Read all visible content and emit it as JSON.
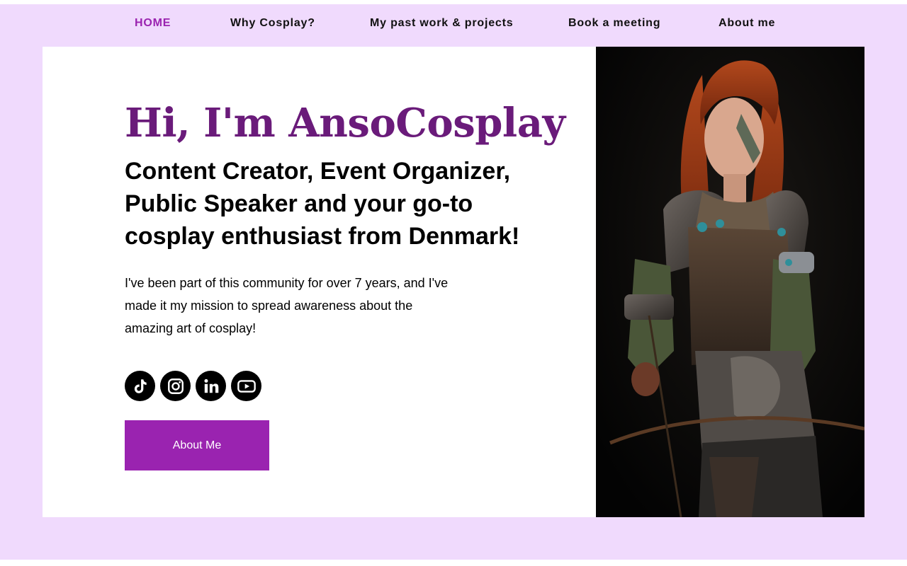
{
  "nav": {
    "items": [
      {
        "label": "HOME",
        "active": true
      },
      {
        "label": "Why Cosplay?",
        "active": false
      },
      {
        "label": "My past work & projects",
        "active": false
      },
      {
        "label": "Book a meeting",
        "active": false
      },
      {
        "label": "About me",
        "active": false
      }
    ]
  },
  "hero": {
    "title": "Hi, I'm AnsoCosplay",
    "subtitle": "Content Creator, Event Organizer, Public Speaker and your go-to cosplay enthusiast from Denmark!",
    "body": "I've been part of this community for over 7 years, and I've made it my mission to spread awareness about the amazing art of cosplay!",
    "cta_label": "About Me"
  },
  "socials": [
    {
      "icon": "tiktok-icon"
    },
    {
      "icon": "instagram-icon"
    },
    {
      "icon": "linkedin-icon"
    },
    {
      "icon": "youtube-icon"
    }
  ],
  "colors": {
    "page_background": "#f0dafd",
    "accent": "#9a23b0",
    "title": "#6a1b7a",
    "card": "#ffffff"
  }
}
